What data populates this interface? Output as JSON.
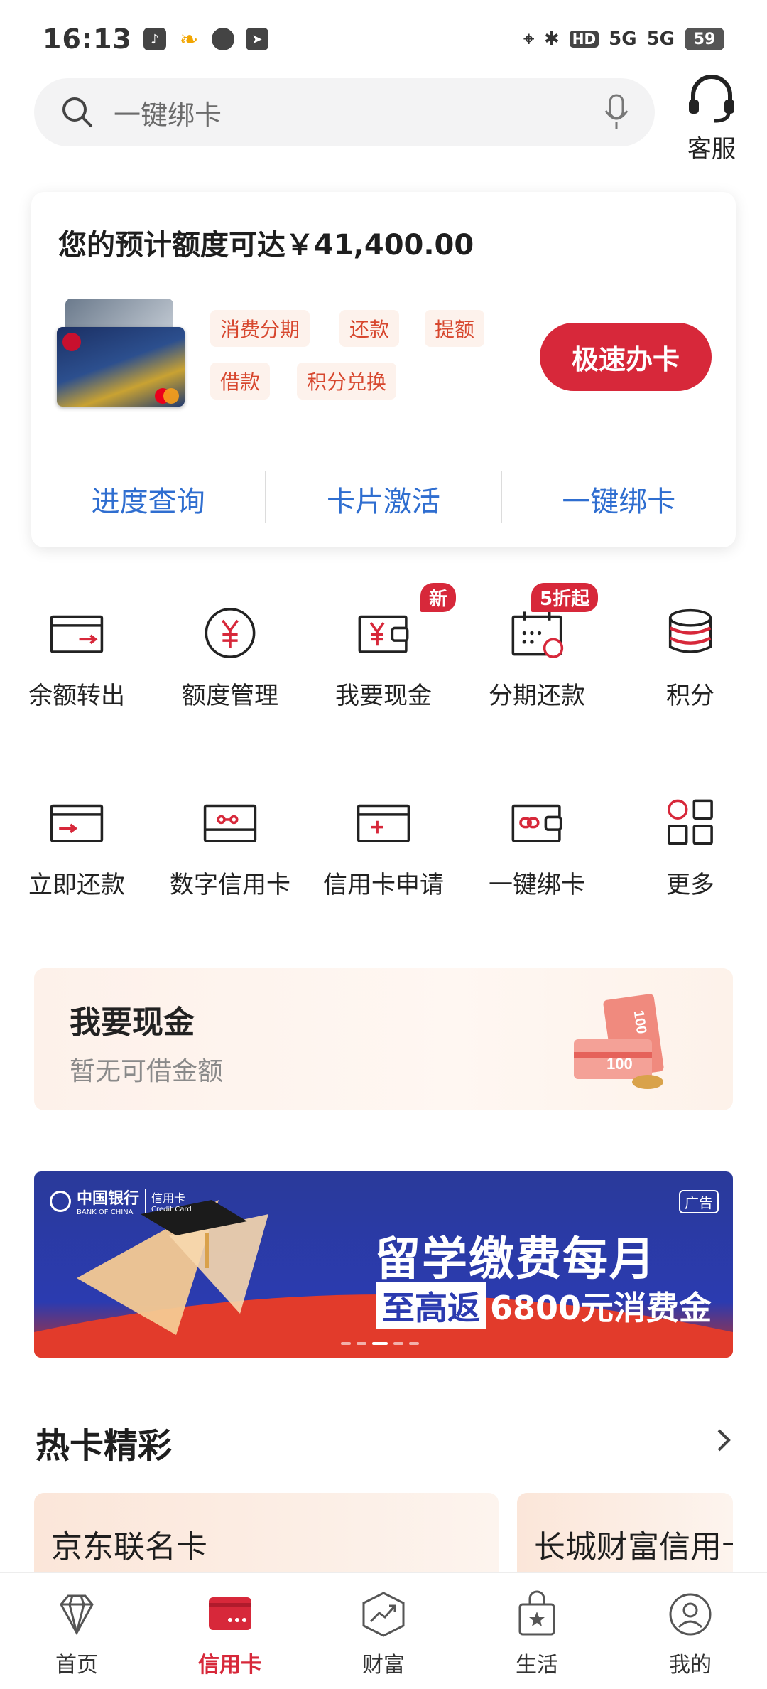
{
  "status_bar": {
    "time": "16:13",
    "hd_label": "HD",
    "net_1": "5G",
    "net_2": "5G",
    "battery": "59"
  },
  "search": {
    "placeholder": "一键绑卡"
  },
  "customer_service": {
    "label": "客服"
  },
  "quota_card": {
    "title": "您的预计额度可达￥41,400.00",
    "tags": [
      "消费分期",
      "还款",
      "提额",
      "借款",
      "积分兑换"
    ],
    "apply_button": "极速办卡",
    "links": [
      "进度查询",
      "卡片激活",
      "一键绑卡"
    ]
  },
  "grid_row1": [
    {
      "label": "余额转出",
      "icon": "transfer-out-icon"
    },
    {
      "label": "额度管理",
      "icon": "yuan-circle-icon"
    },
    {
      "label": "我要现金",
      "icon": "cash-wallet-icon",
      "badge": "新"
    },
    {
      "label": "分期还款",
      "icon": "calendar-icon",
      "badge": "5折起"
    },
    {
      "label": "积分",
      "icon": "coin-stack-icon"
    }
  ],
  "grid_row2": [
    {
      "label": "立即还款",
      "icon": "repay-card-icon"
    },
    {
      "label": "数字信用卡",
      "icon": "digital-card-icon"
    },
    {
      "label": "信用卡申请",
      "icon": "card-apply-icon"
    },
    {
      "label": "一键绑卡",
      "icon": "link-wallet-icon"
    },
    {
      "label": "更多",
      "icon": "grid-more-icon"
    }
  ],
  "cash_banner": {
    "title": "我要现金",
    "subtitle": "暂无可借金额",
    "bill_1": "100",
    "bill_2": "100"
  },
  "ad_banner": {
    "brand": "中国银行",
    "brand_en": "BANK OF CHINA",
    "brand_sub": "信用卡",
    "brand_sub_en": "Credit Card",
    "tag": "广告",
    "headline": "留学缴费每月",
    "sub_box": "至高返",
    "sub_text": "6800元消费金"
  },
  "hot_cards": {
    "title": "热卡精彩",
    "items": [
      "京东联名卡",
      "长城财富信用卡"
    ]
  },
  "nav": [
    {
      "label": "首页",
      "icon": "diamond-icon",
      "active": false
    },
    {
      "label": "信用卡",
      "icon": "credit-card-icon",
      "active": true
    },
    {
      "label": "财富",
      "icon": "wealth-chart-icon",
      "active": false
    },
    {
      "label": "生活",
      "icon": "shopping-bag-icon",
      "active": false
    },
    {
      "label": "我的",
      "icon": "profile-icon",
      "active": false
    }
  ],
  "colors": {
    "accent": "#d7283a",
    "link": "#2f6ed0",
    "tag_text": "#d7472e",
    "tag_bg": "#fdf2ec"
  }
}
